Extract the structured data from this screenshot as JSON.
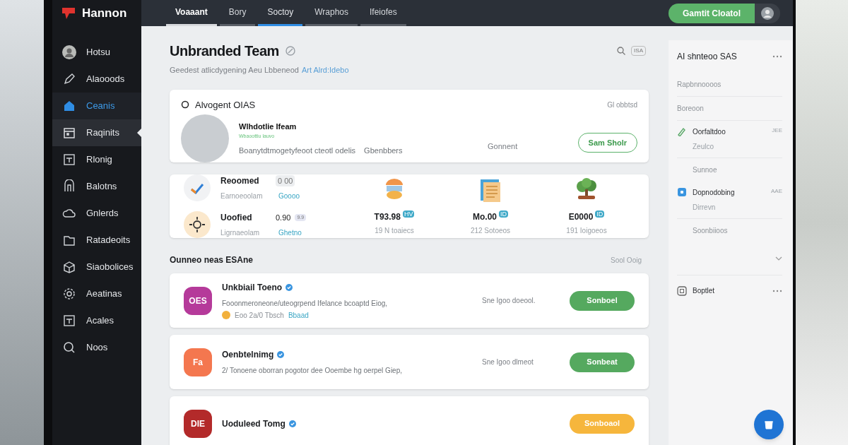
{
  "brand": "Hannon",
  "top_tabs": [
    {
      "label": "Voaaant",
      "selected": false
    },
    {
      "label": "Bory",
      "selected": false
    },
    {
      "label": "Soctoy",
      "selected": true
    },
    {
      "label": "Wraphos",
      "selected": false
    },
    {
      "label": "Ifeiofes",
      "selected": false
    }
  ],
  "top_button": "Gamtit Cloatol",
  "sidebar": {
    "items": [
      {
        "label": "Hotsu",
        "selected": false,
        "highlighted": false
      },
      {
        "label": "Alaooods",
        "selected": false,
        "highlighted": false
      },
      {
        "label": "Ceanis",
        "selected": true,
        "highlighted": false
      },
      {
        "label": "Raqinits",
        "selected": false,
        "highlighted": true
      },
      {
        "label": "Rlonig",
        "selected": false,
        "highlighted": false
      },
      {
        "label": "Balotns",
        "selected": false,
        "highlighted": false
      },
      {
        "label": "Gnlerds",
        "selected": false,
        "highlighted": false
      },
      {
        "label": "Ratadeoits",
        "selected": false,
        "highlighted": false
      },
      {
        "label": "Siaobolices",
        "selected": false,
        "highlighted": false
      },
      {
        "label": "Aeatinas",
        "selected": false,
        "highlighted": false
      },
      {
        "label": "Acales",
        "selected": false,
        "highlighted": false
      },
      {
        "label": "Noos",
        "selected": false,
        "highlighted": false
      }
    ]
  },
  "page": {
    "title": "Unbranded Team",
    "subtitle": "Geedest atlicdygening Aeu Lbbeneod",
    "subtitle_link": "Art Alrd:Idebo",
    "badge": "ISA"
  },
  "profile_card": {
    "header": "Alvogent OIAS",
    "header_right": "Gl obbtsd",
    "name": "Wlhdotlie Ifeam",
    "name_sub": "Wbaoottiu lauvo",
    "description": "Boanytdtmogetyfeoot cteotl odelis",
    "members": "Gbenbbers",
    "comment": "Gonnent",
    "button": "Sam Sholr"
  },
  "stats_card": {
    "rows": [
      {
        "title": "Reoomed",
        "value": "0 00",
        "subtitle": "Earnoeoolam",
        "link": "Goooo"
      },
      {
        "title": "Uoofied",
        "value": "0.90",
        "badge": "9.9",
        "subtitle": "Ligrnaeolam",
        "link": "Ghetno"
      }
    ],
    "columns": [
      {
        "value": "T93.98",
        "badge": "HV",
        "subtitle": "19 N toaiecs"
      },
      {
        "value": "Mo.00",
        "badge": "ID",
        "subtitle": "212 Sotoeos"
      },
      {
        "value": "E0000",
        "badge": "ID",
        "subtitle": "191 Ioigoeos"
      }
    ]
  },
  "section": {
    "title": "Ounneo neas ESAne",
    "action": "Sool Ooig"
  },
  "list_items": [
    {
      "initials": "OES",
      "color": "#b53a9a",
      "title": "Unkbiail Toeno",
      "verified": true,
      "description": "Fooonmeroneone/uteogrpend Ifelance bcoaptd Eiog,",
      "meta": "Eoo 2a/0 Tbsch",
      "meta_link": "Bbaad",
      "note": "Sne Igoo doeool.",
      "button": "Sonboel",
      "kind": "primary"
    },
    {
      "initials": "Fa",
      "color": "#f4774f",
      "title": "Oenbtelnimg",
      "verified": true,
      "description": "2/ Tonoene oborran pogotor dee Ooembe hg oerpel Giep,",
      "note": "Sne Igoo dlmeot",
      "button": "Sonbeat",
      "kind": "primary"
    },
    {
      "initials": "DIE",
      "color": "#b32a2a",
      "title": "Uoduleed Tomg",
      "verified": true,
      "button": "Sonboaol",
      "kind": "warning"
    }
  ],
  "right_panel": {
    "title": "AI shnteoo SAS",
    "items": [
      {
        "kind": "section",
        "label": "Rapbnnoooos"
      },
      {
        "kind": "section",
        "label": "Boreoon"
      },
      {
        "kind": "entry",
        "label": "Oorfaltdoo",
        "sub": "Zeulco",
        "right": "JEE"
      },
      {
        "kind": "subentry",
        "label": "Sunnoe"
      },
      {
        "kind": "entry",
        "label": "Dopnodobing",
        "sub": "Dirrevn",
        "right": "AAE"
      },
      {
        "kind": "subentry",
        "label": "Soonbiioos"
      },
      {
        "kind": "expander"
      },
      {
        "kind": "footer",
        "label": "Boptlet"
      }
    ]
  }
}
